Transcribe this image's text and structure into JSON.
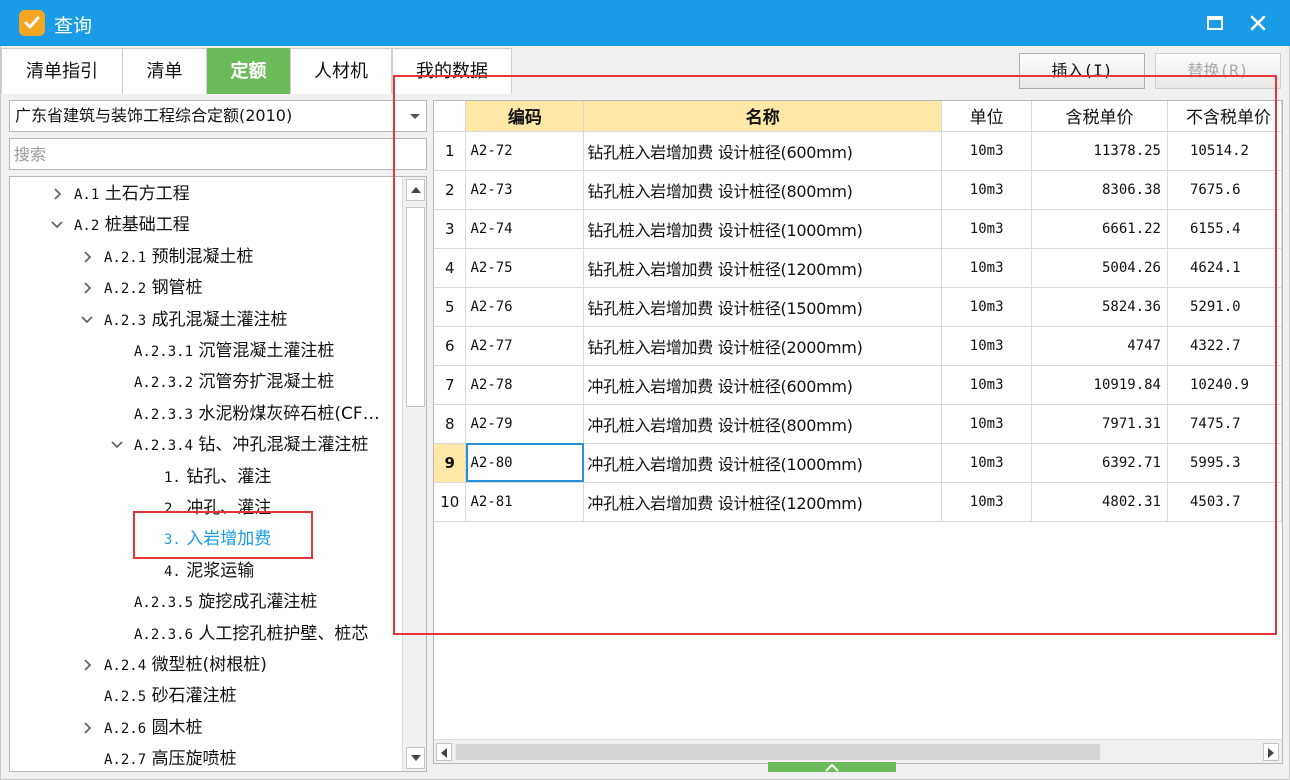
{
  "window": {
    "title": "查询"
  },
  "tabs": [
    {
      "label": "清单指引",
      "active": false
    },
    {
      "label": "清单",
      "active": false
    },
    {
      "label": "定额",
      "active": true
    },
    {
      "label": "人材机",
      "active": false
    },
    {
      "label": "我的数据",
      "active": false
    }
  ],
  "toolbar": {
    "insert_label": "插入(I)",
    "replace_label": "替换(R)"
  },
  "library": {
    "selected": "广东省建筑与装饰工程综合定额(2010)"
  },
  "search": {
    "placeholder": "搜索"
  },
  "tree": [
    {
      "code": "A.1",
      "label": "土石方工程",
      "level": 0,
      "expander": "collapsed",
      "selected": false
    },
    {
      "code": "A.2",
      "label": "桩基础工程",
      "level": 0,
      "expander": "expanded",
      "selected": false
    },
    {
      "code": "A.2.1",
      "label": "预制混凝土桩",
      "level": 1,
      "expander": "collapsed",
      "selected": false
    },
    {
      "code": "A.2.2",
      "label": "钢管桩",
      "level": 1,
      "expander": "collapsed",
      "selected": false
    },
    {
      "code": "A.2.3",
      "label": "成孔混凝土灌注桩",
      "level": 1,
      "expander": "expanded",
      "selected": false
    },
    {
      "code": "A.2.3.1",
      "label": "沉管混凝土灌注桩",
      "level": 2,
      "expander": "none",
      "selected": false
    },
    {
      "code": "A.2.3.2",
      "label": "沉管夯扩混凝土桩",
      "level": 2,
      "expander": "none",
      "selected": false
    },
    {
      "code": "A.2.3.3",
      "label": "水泥粉煤灰碎石桩(CF…",
      "level": 2,
      "expander": "none",
      "selected": false
    },
    {
      "code": "A.2.3.4",
      "label": "钻、冲孔混凝土灌注桩",
      "level": 2,
      "expander": "expanded",
      "selected": false
    },
    {
      "code": "1.",
      "label": "钻孔、灌注",
      "level": 3,
      "expander": "none",
      "selected": false
    },
    {
      "code": "2.",
      "label": "冲孔、灌注",
      "level": 3,
      "expander": "none",
      "selected": false
    },
    {
      "code": "3.",
      "label": "入岩增加费",
      "level": 3,
      "expander": "none",
      "selected": true
    },
    {
      "code": "4.",
      "label": "泥浆运输",
      "level": 3,
      "expander": "none",
      "selected": false
    },
    {
      "code": "A.2.3.5",
      "label": "旋挖成孔灌注桩",
      "level": 2,
      "expander": "none",
      "selected": false
    },
    {
      "code": "A.2.3.6",
      "label": "人工挖孔桩护壁、桩芯",
      "level": 2,
      "expander": "none",
      "selected": false
    },
    {
      "code": "A.2.4",
      "label": "微型桩(树根桩)",
      "level": 1,
      "expander": "collapsed",
      "selected": false
    },
    {
      "code": "A.2.5",
      "label": "砂石灌注桩",
      "level": 1,
      "expander": "none",
      "selected": false
    },
    {
      "code": "A.2.6",
      "label": "圆木桩",
      "level": 1,
      "expander": "collapsed",
      "selected": false
    },
    {
      "code": "A.2.7",
      "label": "高压旋喷桩",
      "level": 1,
      "expander": "none",
      "selected": false
    }
  ],
  "grid": {
    "columns": [
      "编码",
      "名称",
      "单位",
      "含税单价",
      "不含税单价"
    ],
    "rows": [
      {
        "n": "1",
        "code": "A2-72",
        "name": "钻孔桩入岩增加费 设计桩径(600mm)",
        "unit": "10m3",
        "tax": "11378.25",
        "notax": "10514.2"
      },
      {
        "n": "2",
        "code": "A2-73",
        "name": "钻孔桩入岩增加费 设计桩径(800mm)",
        "unit": "10m3",
        "tax": "8306.38",
        "notax": "7675.6"
      },
      {
        "n": "3",
        "code": "A2-74",
        "name": "钻孔桩入岩增加费 设计桩径(1000mm)",
        "unit": "10m3",
        "tax": "6661.22",
        "notax": "6155.4"
      },
      {
        "n": "4",
        "code": "A2-75",
        "name": "钻孔桩入岩增加费 设计桩径(1200mm)",
        "unit": "10m3",
        "tax": "5004.26",
        "notax": "4624.1"
      },
      {
        "n": "5",
        "code": "A2-76",
        "name": "钻孔桩入岩增加费 设计桩径(1500mm)",
        "unit": "10m3",
        "tax": "5824.36",
        "notax": "5291.0"
      },
      {
        "n": "6",
        "code": "A2-77",
        "name": "钻孔桩入岩增加费 设计桩径(2000mm)",
        "unit": "10m3",
        "tax": "4747",
        "notax": "4322.7"
      },
      {
        "n": "7",
        "code": "A2-78",
        "name": "冲孔桩入岩增加费 设计桩径(600mm)",
        "unit": "10m3",
        "tax": "10919.84",
        "notax": "10240.9"
      },
      {
        "n": "8",
        "code": "A2-79",
        "name": "冲孔桩入岩增加费 设计桩径(800mm)",
        "unit": "10m3",
        "tax": "7971.31",
        "notax": "7475.7"
      },
      {
        "n": "9",
        "code": "A2-80",
        "name": "冲孔桩入岩增加费 设计桩径(1000mm)",
        "unit": "10m3",
        "tax": "6392.71",
        "notax": "5995.3"
      },
      {
        "n": "10",
        "code": "A2-81",
        "name": "冲孔桩入岩增加费 设计桩径(1200mm)",
        "unit": "10m3",
        "tax": "4802.31",
        "notax": "4503.7"
      }
    ],
    "active_row": "9"
  },
  "colors": {
    "title_bar": "#1a9be8",
    "active_tab": "#6cbb5a",
    "selected_text": "#1a9be8",
    "header_highlight": "#fde8a8",
    "annotation": "#e5343a"
  }
}
